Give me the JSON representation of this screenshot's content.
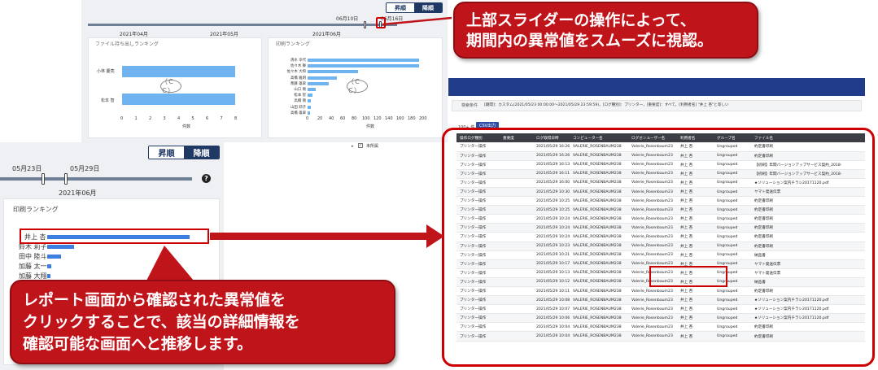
{
  "top_panel": {
    "sort_asc": "昇順",
    "sort_desc": "降順",
    "handle_left_date": "06月10日",
    "handle_right_date": "06月16日",
    "months": [
      "2021年04月",
      "2021年05月",
      "2021年06月"
    ],
    "chart1": {
      "title": "ファイル持ち出しランキング",
      "names": [
        "小林 慶亮",
        "松本 智"
      ],
      "ticks": [
        "0",
        "1",
        "2",
        "3",
        "4",
        "5",
        "6",
        "7",
        "8"
      ],
      "xlabel": "件数",
      "watermark": "（ＣＣ）"
    },
    "chart2": {
      "title": "印刷ランキング",
      "names": [
        "清水 幸代",
        "佐々木 舞",
        "佐々木 大和",
        "高橋 雅明",
        "斎藤 雄翠",
        "山口 剛",
        "松本 智",
        "高橋 剛",
        "山田 莉子",
        "高橋 雄翠"
      ],
      "ticks": [
        "0",
        "20",
        "40",
        "60",
        "80",
        "100",
        "120",
        "140",
        "160",
        "180",
        "200"
      ],
      "xlabel": "件数",
      "watermark": "（ＣＣ）"
    }
  },
  "left_panel": {
    "sort_asc": "昇順",
    "sort_desc": "降順",
    "date_left": "05月23日",
    "date_right": "05月29日",
    "month": "2021年06月",
    "help_icon": "?",
    "chart_title": "印刷ランキング",
    "names": [
      "井上 杏",
      "鈴木 莉子",
      "田中 陸斗",
      "加藤 太一",
      "加藤 大翔"
    ]
  },
  "right_panel": {
    "search_label": "検索条件",
    "search_text": "[期間]：カスタム(2021/05/23 00:00:00〜2021/05/29 23:59:59)，[ログ種別]：プリンター，[重要度]：すべて，[利用者名] \"井上 杏\"と等しい",
    "count_text": "100+ 件",
    "csv_button": "CSV出力",
    "tree_item": "未所属",
    "columns": [
      "操作ログ種別",
      "重要度",
      "ログ取得日時",
      "コンピューター名",
      "ログオンユーザー名",
      "利用者名",
      "グループ名",
      "ファイル名"
    ],
    "rows": [
      [
        "プリンター操作",
        "",
        "2021/05/29 16:26:46",
        "VALERIE_ROSENBAUM238",
        "Valerie_Rosenbaum23",
        "井上 杏",
        "Ungrouped",
        "約定書印刷"
      ],
      [
        "プリンター操作",
        "",
        "2021/05/29 16:26:32",
        "VALERIE_ROSENBAUM238",
        "Valerie_Rosenbaum23",
        "井上 杏",
        "Ungrouped",
        "約定書印刷"
      ],
      [
        "プリンター操作",
        "",
        "2021/05/29 16:13:25",
        "VALERIE_ROSENBAUM238",
        "Valerie_Rosenbaum23",
        "井上 杏",
        "Ungrouped",
        "【初刷】年間バージョンアップサービス契約_2018-"
      ],
      [
        "プリンター操作",
        "",
        "2021/05/29 16:11:44",
        "VALERIE_ROSENBAUM238",
        "Valerie_Rosenbaum23",
        "井上 杏",
        "Ungrouped",
        "【初刷】年間バージョンアップサービス契約_2018-"
      ],
      [
        "プリンター操作",
        "",
        "2021/05/29 16:00:15",
        "VALERIE_ROSENBAUM238",
        "Valerie_Rosenbaum23",
        "井上 杏",
        "Ungrouped",
        "★ソリューション案内チラシ20171120.pdf"
      ],
      [
        "プリンター操作",
        "",
        "2021/05/29 10:30:57",
        "VALERIE_ROSENBAUM238",
        "Valerie_Rosenbaum23",
        "井上 杏",
        "Ungrouped",
        "ヤマト発送伝票"
      ],
      [
        "プリンター操作",
        "",
        "2021/05/29 10:25:09",
        "VALERIE_ROSENBAUM238",
        "Valerie_Rosenbaum23",
        "井上 杏",
        "Ungrouped",
        "約定書印刷"
      ],
      [
        "プリンター操作",
        "",
        "2021/05/29 10:25:00",
        "VALERIE_ROSENBAUM238",
        "Valerie_Rosenbaum23",
        "井上 杏",
        "Ungrouped",
        "約定書印刷"
      ],
      [
        "プリンター操作",
        "",
        "2021/05/29 10:24:48",
        "VALERIE_ROSENBAUM238",
        "Valerie_Rosenbaum23",
        "井上 杏",
        "Ungrouped",
        "約定書印刷"
      ],
      [
        "プリンター操作",
        "",
        "2021/05/29 10:24:33",
        "VALERIE_ROSENBAUM238",
        "Valerie_Rosenbaum23",
        "井上 杏",
        "Ungrouped",
        "約定書印刷"
      ],
      [
        "プリンター操作",
        "",
        "2021/05/29 10:24:22",
        "VALERIE_ROSENBAUM238",
        "Valerie_Rosenbaum23",
        "井上 杏",
        "Ungrouped",
        "約定書印刷"
      ],
      [
        "プリンター操作",
        "",
        "2021/05/29 10:23:38",
        "VALERIE_ROSENBAUM238",
        "Valerie_Rosenbaum23",
        "井上 杏",
        "Ungrouped",
        "約定書印刷"
      ],
      [
        "プリンター操作",
        "",
        "2021/05/29 10:21:24",
        "VALERIE_ROSENBAUM238",
        "Valerie_Rosenbaum23",
        "井上 杏",
        "Ungrouped",
        "納品書"
      ],
      [
        "プリンター操作",
        "",
        "2021/05/29 10:17:24",
        "VALERIE_ROSENBAUM238",
        "Valerie_Rosenbaum23",
        "井上 杏",
        "Ungrouped",
        "ヤマト発送伝票"
      ],
      [
        "プリンター操作",
        "",
        "2021/05/29 10:13:56",
        "VALERIE_ROSENBAUM238",
        "Valerie_Rosenbaum23",
        "井上 杏",
        "Ungrouped",
        "ヤマト発送伝票"
      ],
      [
        "プリンター操作",
        "",
        "2021/05/29 10:12:11",
        "VALERIE_ROSENBAUM238",
        "Valerie_Rosenbaum23",
        "井上 杏",
        "Ungrouped",
        "納品書"
      ],
      [
        "プリンター操作",
        "",
        "2021/05/29 10:11:12",
        "VALERIE_ROSENBAUM238",
        "Valerie_Rosenbaum23",
        "井上 杏",
        "Ungrouped",
        "約定書印刷"
      ],
      [
        "プリンター操作",
        "",
        "2021/05/29 10:08:16",
        "VALERIE_ROSENBAUM238",
        "Valerie_Rosenbaum23",
        "井上 杏",
        "Ungrouped",
        "★ソリューション案内チラシ20171120.pdf"
      ],
      [
        "プリンター操作",
        "",
        "2021/05/29 10:07:23",
        "VALERIE_ROSENBAUM238",
        "Valerie_Rosenbaum23",
        "井上 杏",
        "Ungrouped",
        "★ソリューション案内チラシ20171120.pdf"
      ],
      [
        "プリンター操作",
        "",
        "2021/05/29 10:06:39",
        "VALERIE_ROSENBAUM238",
        "Valerie_Rosenbaum23",
        "井上 杏",
        "Ungrouped",
        "★ソリューション案内チラシ20171120.pdf"
      ],
      [
        "プリンター操作",
        "",
        "2021/05/29 10:04:39",
        "VALERIE_ROSENBAUM238",
        "Valerie_Rosenbaum23",
        "井上 杏",
        "Ungrouped",
        "約定書印刷"
      ],
      [
        "プリンター操作",
        "",
        "2021/05/29 10:04:27",
        "VALERIE_ROSENBAUM238",
        "Valerie_Rosenbaum23",
        "井上 杏",
        "Ungrouped",
        "約定書印刷"
      ]
    ]
  },
  "callouts": {
    "top": [
      "上部スライダーの操作によって、",
      "期間内の異常値をスムーズに視認。"
    ],
    "bottom": [
      "レポート画面から確認された異常値を",
      "クリックすることで、該当の詳細情報を",
      "確認可能な画面へと推移します。"
    ]
  },
  "colors": {
    "accent": "#c0141b",
    "navy": "#1f3864",
    "bar": "#6fb3f0"
  }
}
